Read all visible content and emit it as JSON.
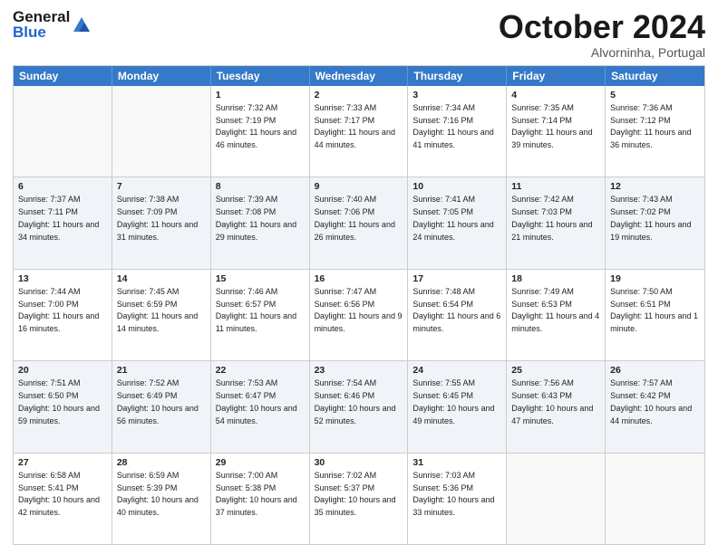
{
  "logo": {
    "line1": "General",
    "line2": "Blue"
  },
  "title": "October 2024",
  "subtitle": "Alvorninha, Portugal",
  "days": [
    "Sunday",
    "Monday",
    "Tuesday",
    "Wednesday",
    "Thursday",
    "Friday",
    "Saturday"
  ],
  "rows": [
    [
      {
        "day": "",
        "text": ""
      },
      {
        "day": "",
        "text": ""
      },
      {
        "day": "1",
        "text": "Sunrise: 7:32 AM\nSunset: 7:19 PM\nDaylight: 11 hours and 46 minutes."
      },
      {
        "day": "2",
        "text": "Sunrise: 7:33 AM\nSunset: 7:17 PM\nDaylight: 11 hours and 44 minutes."
      },
      {
        "day": "3",
        "text": "Sunrise: 7:34 AM\nSunset: 7:16 PM\nDaylight: 11 hours and 41 minutes."
      },
      {
        "day": "4",
        "text": "Sunrise: 7:35 AM\nSunset: 7:14 PM\nDaylight: 11 hours and 39 minutes."
      },
      {
        "day": "5",
        "text": "Sunrise: 7:36 AM\nSunset: 7:12 PM\nDaylight: 11 hours and 36 minutes."
      }
    ],
    [
      {
        "day": "6",
        "text": "Sunrise: 7:37 AM\nSunset: 7:11 PM\nDaylight: 11 hours and 34 minutes."
      },
      {
        "day": "7",
        "text": "Sunrise: 7:38 AM\nSunset: 7:09 PM\nDaylight: 11 hours and 31 minutes."
      },
      {
        "day": "8",
        "text": "Sunrise: 7:39 AM\nSunset: 7:08 PM\nDaylight: 11 hours and 29 minutes."
      },
      {
        "day": "9",
        "text": "Sunrise: 7:40 AM\nSunset: 7:06 PM\nDaylight: 11 hours and 26 minutes."
      },
      {
        "day": "10",
        "text": "Sunrise: 7:41 AM\nSunset: 7:05 PM\nDaylight: 11 hours and 24 minutes."
      },
      {
        "day": "11",
        "text": "Sunrise: 7:42 AM\nSunset: 7:03 PM\nDaylight: 11 hours and 21 minutes."
      },
      {
        "day": "12",
        "text": "Sunrise: 7:43 AM\nSunset: 7:02 PM\nDaylight: 11 hours and 19 minutes."
      }
    ],
    [
      {
        "day": "13",
        "text": "Sunrise: 7:44 AM\nSunset: 7:00 PM\nDaylight: 11 hours and 16 minutes."
      },
      {
        "day": "14",
        "text": "Sunrise: 7:45 AM\nSunset: 6:59 PM\nDaylight: 11 hours and 14 minutes."
      },
      {
        "day": "15",
        "text": "Sunrise: 7:46 AM\nSunset: 6:57 PM\nDaylight: 11 hours and 11 minutes."
      },
      {
        "day": "16",
        "text": "Sunrise: 7:47 AM\nSunset: 6:56 PM\nDaylight: 11 hours and 9 minutes."
      },
      {
        "day": "17",
        "text": "Sunrise: 7:48 AM\nSunset: 6:54 PM\nDaylight: 11 hours and 6 minutes."
      },
      {
        "day": "18",
        "text": "Sunrise: 7:49 AM\nSunset: 6:53 PM\nDaylight: 11 hours and 4 minutes."
      },
      {
        "day": "19",
        "text": "Sunrise: 7:50 AM\nSunset: 6:51 PM\nDaylight: 11 hours and 1 minute."
      }
    ],
    [
      {
        "day": "20",
        "text": "Sunrise: 7:51 AM\nSunset: 6:50 PM\nDaylight: 10 hours and 59 minutes."
      },
      {
        "day": "21",
        "text": "Sunrise: 7:52 AM\nSunset: 6:49 PM\nDaylight: 10 hours and 56 minutes."
      },
      {
        "day": "22",
        "text": "Sunrise: 7:53 AM\nSunset: 6:47 PM\nDaylight: 10 hours and 54 minutes."
      },
      {
        "day": "23",
        "text": "Sunrise: 7:54 AM\nSunset: 6:46 PM\nDaylight: 10 hours and 52 minutes."
      },
      {
        "day": "24",
        "text": "Sunrise: 7:55 AM\nSunset: 6:45 PM\nDaylight: 10 hours and 49 minutes."
      },
      {
        "day": "25",
        "text": "Sunrise: 7:56 AM\nSunset: 6:43 PM\nDaylight: 10 hours and 47 minutes."
      },
      {
        "day": "26",
        "text": "Sunrise: 7:57 AM\nSunset: 6:42 PM\nDaylight: 10 hours and 44 minutes."
      }
    ],
    [
      {
        "day": "27",
        "text": "Sunrise: 6:58 AM\nSunset: 5:41 PM\nDaylight: 10 hours and 42 minutes."
      },
      {
        "day": "28",
        "text": "Sunrise: 6:59 AM\nSunset: 5:39 PM\nDaylight: 10 hours and 40 minutes."
      },
      {
        "day": "29",
        "text": "Sunrise: 7:00 AM\nSunset: 5:38 PM\nDaylight: 10 hours and 37 minutes."
      },
      {
        "day": "30",
        "text": "Sunrise: 7:02 AM\nSunset: 5:37 PM\nDaylight: 10 hours and 35 minutes."
      },
      {
        "day": "31",
        "text": "Sunrise: 7:03 AM\nSunset: 5:36 PM\nDaylight: 10 hours and 33 minutes."
      },
      {
        "day": "",
        "text": ""
      },
      {
        "day": "",
        "text": ""
      }
    ]
  ]
}
